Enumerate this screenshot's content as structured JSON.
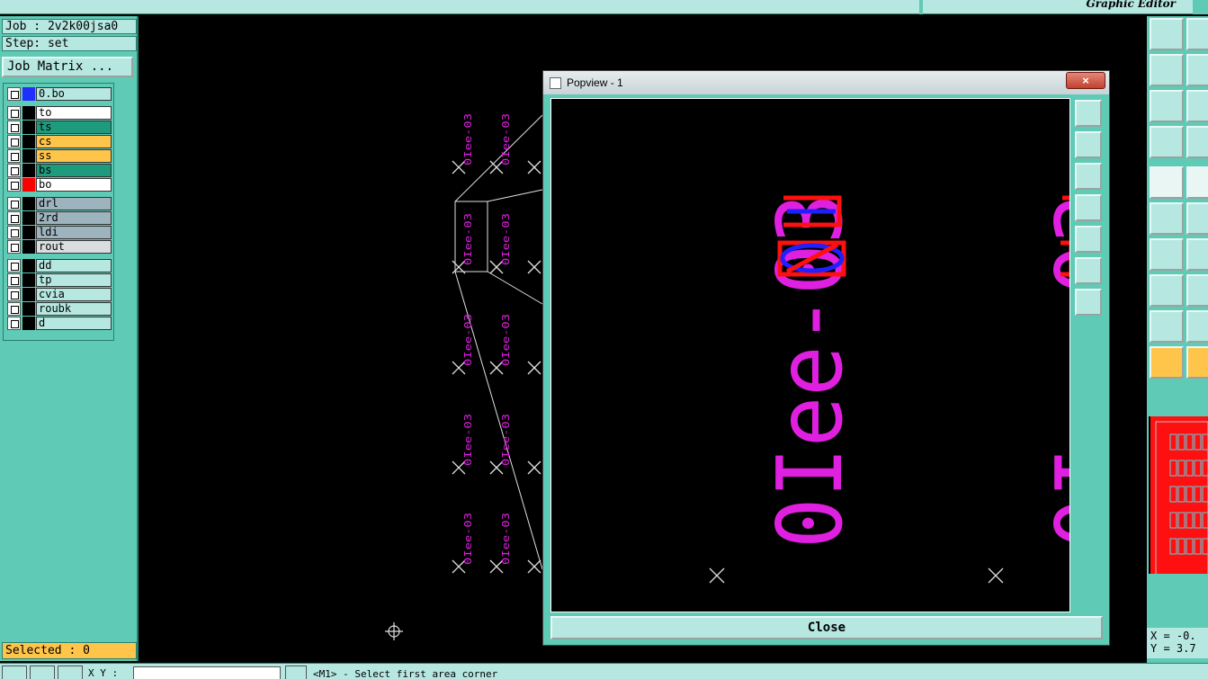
{
  "app": {
    "brand": "Graphic Editor"
  },
  "left_panel": {
    "job": "Job : 2v2k00jsa0",
    "step": "Step: set",
    "job_matrix_button": "Job Matrix ...",
    "layers": [
      {
        "name": "0.bo",
        "color": "#1f2fff",
        "bg": "#b6e7e1"
      },
      {
        "name": "to",
        "color": "#000000",
        "bg": "#ffffff"
      },
      {
        "name": "ts",
        "color": "#000000",
        "bg": "#1e9a7c"
      },
      {
        "name": "cs",
        "color": "#000000",
        "bg": "#ffc44a"
      },
      {
        "name": "ss",
        "color": "#000000",
        "bg": "#ffc44a"
      },
      {
        "name": "bs",
        "color": "#000000",
        "bg": "#1e9a7c"
      },
      {
        "name": "bo",
        "color": "#ff0000",
        "bg": "#ffffff"
      },
      {
        "name": "drl",
        "color": "#000000",
        "bg": "#9db3bd"
      },
      {
        "name": "2rd",
        "color": "#000000",
        "bg": "#9db3bd"
      },
      {
        "name": "ldi",
        "color": "#000000",
        "bg": "#9db3bd"
      },
      {
        "name": "rout",
        "color": "#000000",
        "bg": "#d9dde0"
      },
      {
        "name": "dd",
        "color": "#000000",
        "bg": "#b6e7e1"
      },
      {
        "name": "tp",
        "color": "#000000",
        "bg": "#b6e7e1"
      },
      {
        "name": "cvia",
        "color": "#000000",
        "bg": "#b6e7e1"
      },
      {
        "name": "roubk",
        "color": "#000000",
        "bg": "#b6e7e1"
      },
      {
        "name": "d",
        "color": "#000000",
        "bg": "#b6e7e1"
      }
    ],
    "selected": "Selected : 0"
  },
  "canvas": {
    "label_text": "0Iee-03",
    "popup_label": "0Iee-03"
  },
  "popup": {
    "title": "Popview - 1",
    "close_x": "×",
    "close_button": "Close"
  },
  "bottom": {
    "xy_label": "X Y :",
    "message": "<M1> - Select first area corner"
  },
  "coords": {
    "x": "X = -0.",
    "y": "Y = 3.7"
  },
  "colors": {
    "panel": "#5fcab5",
    "field": "#b6e7e1",
    "label": "#e020e0",
    "highlight": "#ffc44a"
  }
}
